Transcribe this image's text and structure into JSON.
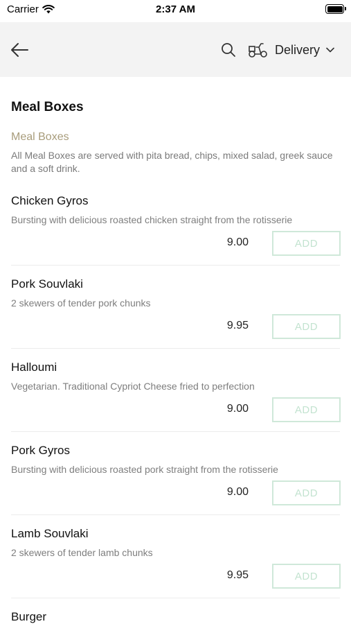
{
  "status_bar": {
    "carrier": "Carrier",
    "time": "2:37 AM",
    "battery_level": 1.0
  },
  "nav": {
    "back_icon": "arrow-left-icon",
    "search_icon": "search-icon",
    "delivery_icon": "delivery-scooter-icon",
    "mode_label": "Delivery",
    "chevron_icon": "chevron-down-icon"
  },
  "menu": {
    "section_title": "Meal Boxes",
    "category_title": "Meal Boxes",
    "category_description": "All Meal Boxes are served with pita bread, chips, mixed salad, greek sauce and a soft drink.",
    "add_label": "ADD",
    "items": [
      {
        "name": "Chicken Gyros",
        "description": "Bursting with delicious roasted chicken straight from the rotisserie",
        "price": "9.00"
      },
      {
        "name": "Pork Souvlaki",
        "description": "2 skewers of tender pork chunks",
        "price": "9.95"
      },
      {
        "name": "Halloumi",
        "description": "Vegetarian. Traditional Cypriot Cheese fried to perfection",
        "price": "9.00"
      },
      {
        "name": "Pork Gyros",
        "description": "Bursting with delicious roasted pork straight from the rotisserie",
        "price": "9.00"
      },
      {
        "name": "Lamb Souvlaki",
        "description": "2 skewers of tender lamb chunks",
        "price": "9.95"
      },
      {
        "name": "Burger",
        "description": "",
        "price": ""
      }
    ]
  },
  "colors": {
    "nav_background": "#f3f3f3",
    "category_accent": "#a89c7b",
    "add_button_border": "#cfe8d9",
    "add_button_text": "#c3e3d0"
  }
}
